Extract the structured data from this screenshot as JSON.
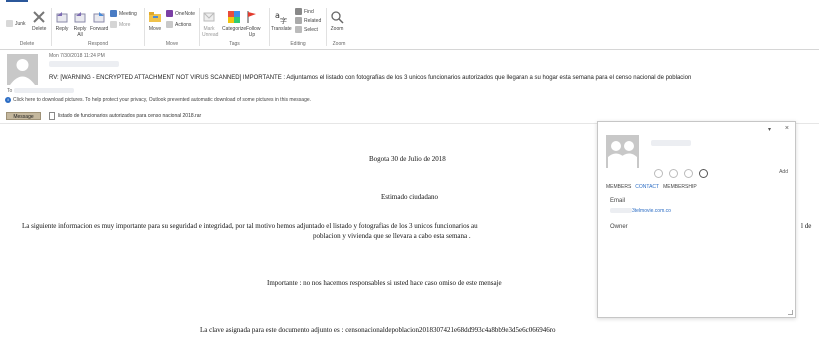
{
  "ribbon": {
    "delete_group": {
      "label": "Delete",
      "junk": "Junk",
      "delete": "Delete"
    },
    "respond_group": {
      "label": "Respond",
      "reply": "Reply",
      "reply_all": "Reply All",
      "forward": "Forward",
      "meeting": "Meeting",
      "more": "More"
    },
    "move_group": {
      "label": "Move",
      "move": "Move",
      "onenote": "OneNote",
      "actions": "Actions"
    },
    "tags_group": {
      "label": "Tags",
      "mark_unread": "Mark Unread",
      "categorize": "Categorize",
      "follow_up": "Follow Up"
    },
    "editing_group": {
      "label": "Editing",
      "translate": "Translate",
      "find": "Find",
      "related": "Related",
      "select": "Select"
    },
    "zoom_group": {
      "label": "Zoom",
      "zoom": "Zoom"
    }
  },
  "message": {
    "date": "Mon 7/30/2018 11:24 PM",
    "subject": "RV: [WARNING - ENCRYPTED ATTACHMENT NOT VIRUS SCANNED]  IMPORTANTE : Adjuntamos el listado con fotografías de los 3 unicos funcionarios autorizados que llegaran a su hogar esta semana para el censo nacional de poblacion",
    "to_label": "To",
    "info_bar": "Click here to download pictures. To help protect your privacy, Outlook prevented automatic download of some pictures in this message.",
    "message_tab": "Message",
    "attachment": "listado de funcionarios autorizados para censo nacional 2018.rar"
  },
  "body": {
    "date_line": "Bogota 30 de Julio de 2018",
    "greeting": "Estimado ciudadano",
    "paragraph_line1": "La siguiente informacion es muy importante para su seguridad e integridad, por tal motivo hemos adjuntado el listado y fotografias de los 3 unicos funcionarios au",
    "paragraph_line1_tail": "l de",
    "paragraph_line2": "poblacion y vivienda que se llevara a cabo esta semana .",
    "important": "Importante : no nos hacemos responsables si usted hace caso omiso de este mensaje",
    "key_line": "La clave asignada para este documento adjunto es :  censonacionaldepoblacion2018307421e68dd993c4a8bb9e3d5e6c066946ro"
  },
  "contact_card": {
    "add": "Add",
    "tabs": [
      "MEMBERS",
      "CONTACT",
      "MEMBERSHIP"
    ],
    "active_tab": "CONTACT",
    "email_label": "Email",
    "email_value": "3telmovie.com.co",
    "owner_label": "Owner"
  }
}
